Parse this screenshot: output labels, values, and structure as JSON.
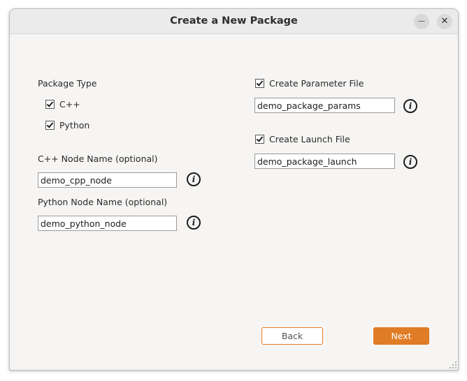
{
  "window": {
    "title": "Create a New Package",
    "minimize_glyph": "—",
    "close_glyph": "✕"
  },
  "left": {
    "package_type_label": "Package Type",
    "cpp_checkbox": {
      "label": "C++",
      "checked": true
    },
    "python_checkbox": {
      "label": "Python",
      "checked": true
    },
    "cpp_node_label": "C++ Node Name (optional)",
    "cpp_node_value": "demo_cpp_node",
    "python_node_label": "Python Node Name (optional)",
    "python_node_value": "demo_python_node"
  },
  "right": {
    "param_checkbox": {
      "label": "Create Parameter File",
      "checked": true
    },
    "param_value": "demo_package_params",
    "launch_checkbox": {
      "label": "Create Launch File",
      "checked": true
    },
    "launch_value": "demo_package_launch"
  },
  "info_icon_glyph": "i",
  "footer": {
    "back_label": "Back",
    "next_label": "Next"
  },
  "colors": {
    "accent": "#e07b26"
  }
}
